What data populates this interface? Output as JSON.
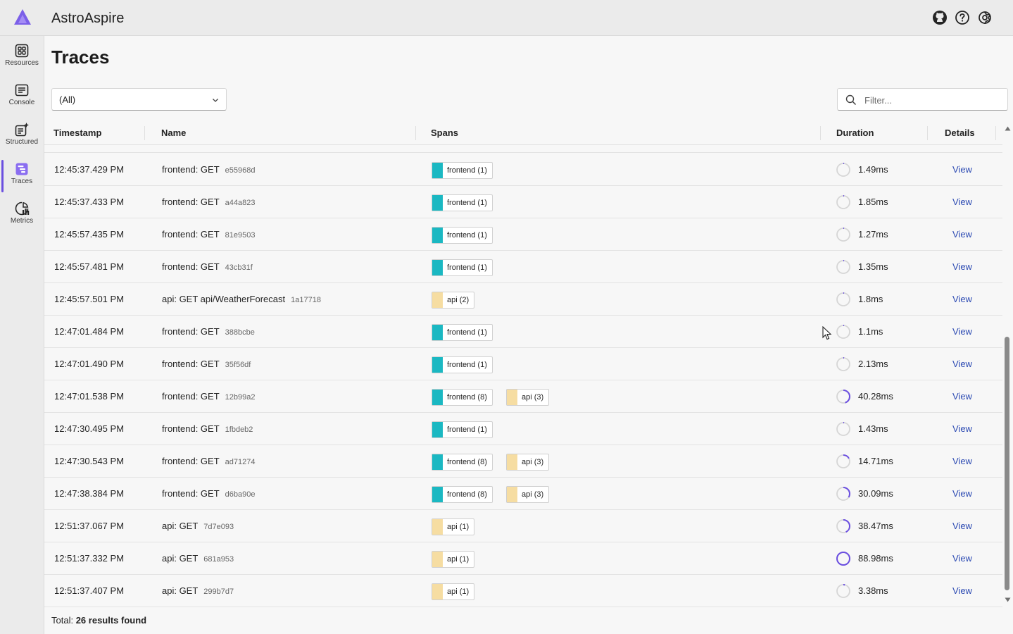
{
  "app": {
    "title": "AstroAspire"
  },
  "sidebar": {
    "items": [
      {
        "label": "Resources",
        "icon": "resources-icon"
      },
      {
        "label": "Console",
        "icon": "console-icon"
      },
      {
        "label": "Structured",
        "icon": "structured-icon"
      },
      {
        "label": "Traces",
        "icon": "traces-icon",
        "active": true
      },
      {
        "label": "Metrics",
        "icon": "metrics-icon"
      }
    ]
  },
  "header_icons": [
    "github-icon",
    "help-icon",
    "settings-icon"
  ],
  "page": {
    "title": "Traces",
    "select_value": "(All)",
    "filter_placeholder": "Filter..."
  },
  "table": {
    "columns": [
      "Timestamp",
      "Name",
      "Spans",
      "Duration",
      "Details"
    ],
    "rows": [
      {
        "timestamp": "12:45:37.429 PM",
        "name": "frontend: GET",
        "trace_id": "e55968d",
        "spans": [
          {
            "label": "frontend (1)",
            "service": "frontend"
          }
        ],
        "duration": "1.49ms",
        "duration_fraction": 0.02,
        "details": "View"
      },
      {
        "timestamp": "12:45:37.433 PM",
        "name": "frontend: GET",
        "trace_id": "a44a823",
        "spans": [
          {
            "label": "frontend (1)",
            "service": "frontend"
          }
        ],
        "duration": "1.85ms",
        "duration_fraction": 0.02,
        "details": "View"
      },
      {
        "timestamp": "12:45:57.435 PM",
        "name": "frontend: GET",
        "trace_id": "81e9503",
        "spans": [
          {
            "label": "frontend (1)",
            "service": "frontend"
          }
        ],
        "duration": "1.27ms",
        "duration_fraction": 0.02,
        "details": "View"
      },
      {
        "timestamp": "12:45:57.481 PM",
        "name": "frontend: GET",
        "trace_id": "43cb31f",
        "spans": [
          {
            "label": "frontend (1)",
            "service": "frontend"
          }
        ],
        "duration": "1.35ms",
        "duration_fraction": 0.02,
        "details": "View"
      },
      {
        "timestamp": "12:45:57.501 PM",
        "name": "api: GET api/WeatherForecast",
        "trace_id": "1a17718",
        "spans": [
          {
            "label": "api (2)",
            "service": "api"
          }
        ],
        "duration": "1.8ms",
        "duration_fraction": 0.02,
        "details": "View"
      },
      {
        "timestamp": "12:47:01.484 PM",
        "name": "frontend: GET",
        "trace_id": "388bcbe",
        "spans": [
          {
            "label": "frontend (1)",
            "service": "frontend"
          }
        ],
        "duration": "1.1ms",
        "duration_fraction": 0.01,
        "details": "View"
      },
      {
        "timestamp": "12:47:01.490 PM",
        "name": "frontend: GET",
        "trace_id": "35f56df",
        "spans": [
          {
            "label": "frontend (1)",
            "service": "frontend"
          }
        ],
        "duration": "2.13ms",
        "duration_fraction": 0.02,
        "details": "View"
      },
      {
        "timestamp": "12:47:01.538 PM",
        "name": "frontend: GET",
        "trace_id": "12b99a2",
        "spans": [
          {
            "label": "frontend (8)",
            "service": "frontend"
          },
          {
            "label": "api (3)",
            "service": "api"
          }
        ],
        "duration": "40.28ms",
        "duration_fraction": 0.45,
        "details": "View"
      },
      {
        "timestamp": "12:47:30.495 PM",
        "name": "frontend: GET",
        "trace_id": "1fbdeb2",
        "spans": [
          {
            "label": "frontend (1)",
            "service": "frontend"
          }
        ],
        "duration": "1.43ms",
        "duration_fraction": 0.02,
        "details": "View"
      },
      {
        "timestamp": "12:47:30.543 PM",
        "name": "frontend: GET",
        "trace_id": "ad71274",
        "spans": [
          {
            "label": "frontend (8)",
            "service": "frontend"
          },
          {
            "label": "api (3)",
            "service": "api"
          }
        ],
        "duration": "14.71ms",
        "duration_fraction": 0.17,
        "details": "View"
      },
      {
        "timestamp": "12:47:38.384 PM",
        "name": "frontend: GET",
        "trace_id": "d6ba90e",
        "spans": [
          {
            "label": "frontend (8)",
            "service": "frontend"
          },
          {
            "label": "api (3)",
            "service": "api"
          }
        ],
        "duration": "30.09ms",
        "duration_fraction": 0.34,
        "details": "View"
      },
      {
        "timestamp": "12:51:37.067 PM",
        "name": "api: GET",
        "trace_id": "7d7e093",
        "spans": [
          {
            "label": "api (1)",
            "service": "api"
          }
        ],
        "duration": "38.47ms",
        "duration_fraction": 0.43,
        "details": "View"
      },
      {
        "timestamp": "12:51:37.332 PM",
        "name": "api: GET",
        "trace_id": "681a953",
        "spans": [
          {
            "label": "api (1)",
            "service": "api"
          }
        ],
        "duration": "88.98ms",
        "duration_fraction": 1.0,
        "details": "View"
      },
      {
        "timestamp": "12:51:37.407 PM",
        "name": "api: GET",
        "trace_id": "299b7d7",
        "spans": [
          {
            "label": "api (1)",
            "service": "api"
          }
        ],
        "duration": "3.38ms",
        "duration_fraction": 0.04,
        "details": "View"
      }
    ]
  },
  "footer": {
    "total_label": "Total:",
    "total_value": "26 results found"
  },
  "colors": {
    "frontend": "#1bb8c2",
    "api": "#f6dda2",
    "accent": "#6b4fe0",
    "link": "#2d4bb3"
  }
}
